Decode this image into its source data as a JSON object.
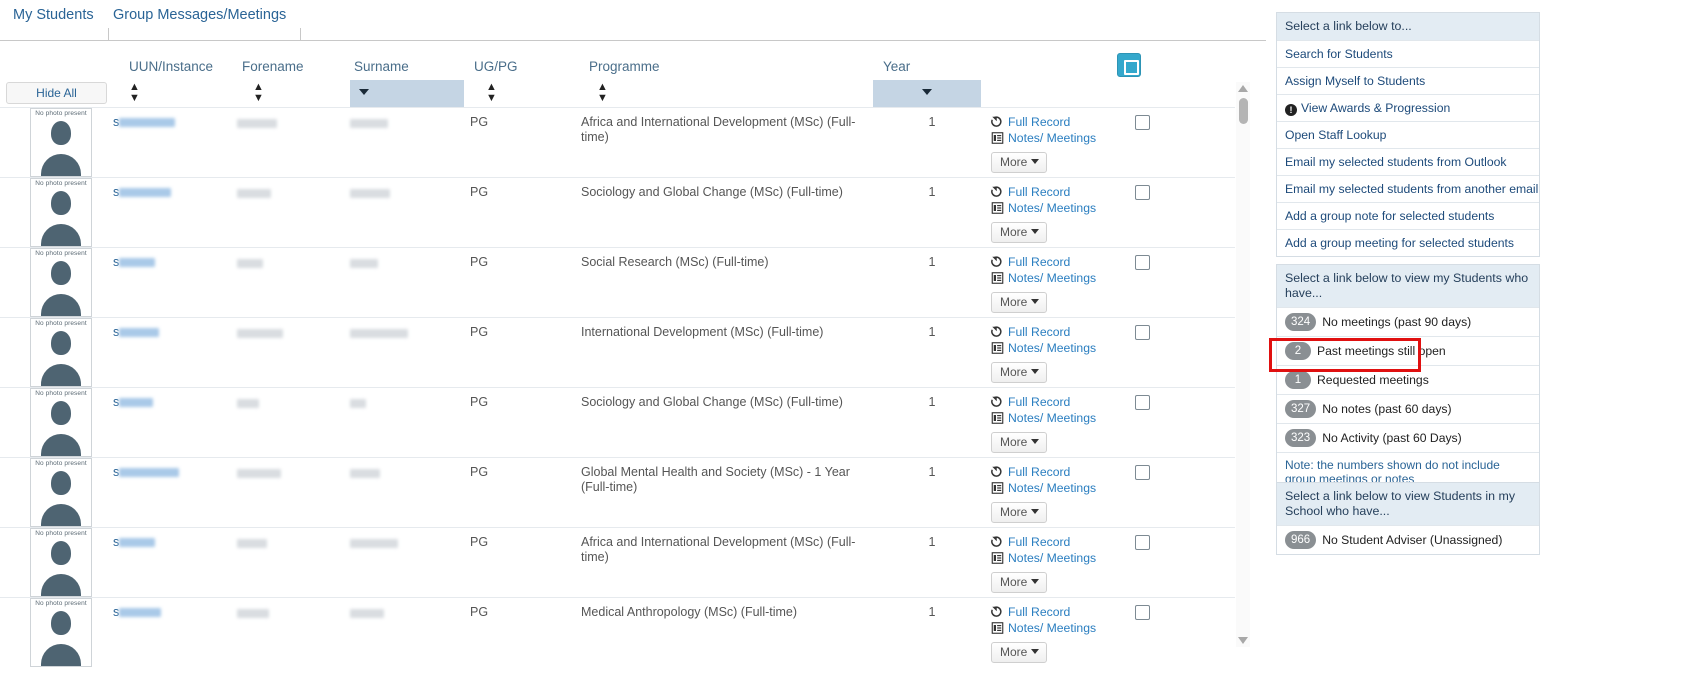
{
  "tabs": [
    {
      "label": "My Students",
      "active": true
    },
    {
      "label": "Group Messages/Meetings",
      "active": false
    }
  ],
  "table": {
    "hide_all_label": "Hide All",
    "columns": [
      {
        "key": "photo",
        "label": ""
      },
      {
        "key": "uun",
        "label": "UUN/Instance"
      },
      {
        "key": "forename",
        "label": "Forename"
      },
      {
        "key": "surname",
        "label": "Surname"
      },
      {
        "key": "ugpg",
        "label": "UG/PG"
      },
      {
        "key": "programme",
        "label": "Programme"
      },
      {
        "key": "year",
        "label": "Year"
      },
      {
        "key": "actions",
        "label": ""
      },
      {
        "key": "select",
        "label": ""
      }
    ],
    "avatar_caption": "No photo present",
    "uun_prefix": "s",
    "actions": {
      "full_record": "Full Record",
      "notes_meetings": "Notes/ Meetings",
      "more": "More"
    },
    "rows": [
      {
        "ugpg": "PG",
        "programme": "Africa and International Development (MSc) (Full-time)",
        "year": "1"
      },
      {
        "ugpg": "PG",
        "programme": "Sociology and Global Change (MSc) (Full-time)",
        "year": "1"
      },
      {
        "ugpg": "PG",
        "programme": "Social Research (MSc) (Full-time)",
        "year": "1"
      },
      {
        "ugpg": "PG",
        "programme": "International Development (MSc) (Full-time)",
        "year": "1"
      },
      {
        "ugpg": "PG",
        "programme": "Sociology and Global Change (MSc) (Full-time)",
        "year": "1"
      },
      {
        "ugpg": "PG",
        "programme": "Global Mental Health and Society (MSc) - 1 Year (Full-time)",
        "year": "1"
      },
      {
        "ugpg": "PG",
        "programme": "Africa and International Development (MSc) (Full-time)",
        "year": "1"
      },
      {
        "ugpg": "PG",
        "programme": "Medical Anthropology (MSc) (Full-time)",
        "year": "1"
      }
    ]
  },
  "panels": {
    "links": {
      "header": "Select a link below to...",
      "items": [
        {
          "label": "Search for Students",
          "icon": null
        },
        {
          "label": "Assign Myself to Students",
          "icon": null
        },
        {
          "label": "View Awards & Progression",
          "icon": "exclamation-icon"
        },
        {
          "label": "Open Staff Lookup",
          "icon": null
        },
        {
          "label": "Email my selected students from Outlook",
          "icon": null
        },
        {
          "label": "Email my selected students from another email client",
          "icon": null
        },
        {
          "label": "Add a group note for selected students",
          "icon": null
        },
        {
          "label": "Add a group meeting for selected students",
          "icon": null
        }
      ]
    },
    "my_students": {
      "header": "Select a link below to view my Students who have...",
      "items": [
        {
          "count": "324",
          "label": "No meetings (past 90 days)"
        },
        {
          "count": "2",
          "label": "Past meetings still open"
        },
        {
          "count": "1",
          "label": "Requested meetings",
          "highlighted": true
        },
        {
          "count": "327",
          "label": "No notes (past 60 days)"
        },
        {
          "count": "323",
          "label": "No Activity (past 60 Days)"
        }
      ],
      "note": "Note: the numbers shown do not include group meetings or notes"
    },
    "school": {
      "header": "Select a link below to view Students in my School who have...",
      "items": [
        {
          "count": "966",
          "label": "No Student Adviser (Unassigned)"
        }
      ]
    }
  },
  "colors": {
    "accent_cyan": "#34a8cc",
    "link_blue": "#2a6496",
    "panel_header_bg": "#e3ecf3",
    "filter_bg": "#c5d5e4",
    "highlight_red": "#e01010",
    "pill_gray": "#8a8f93"
  }
}
